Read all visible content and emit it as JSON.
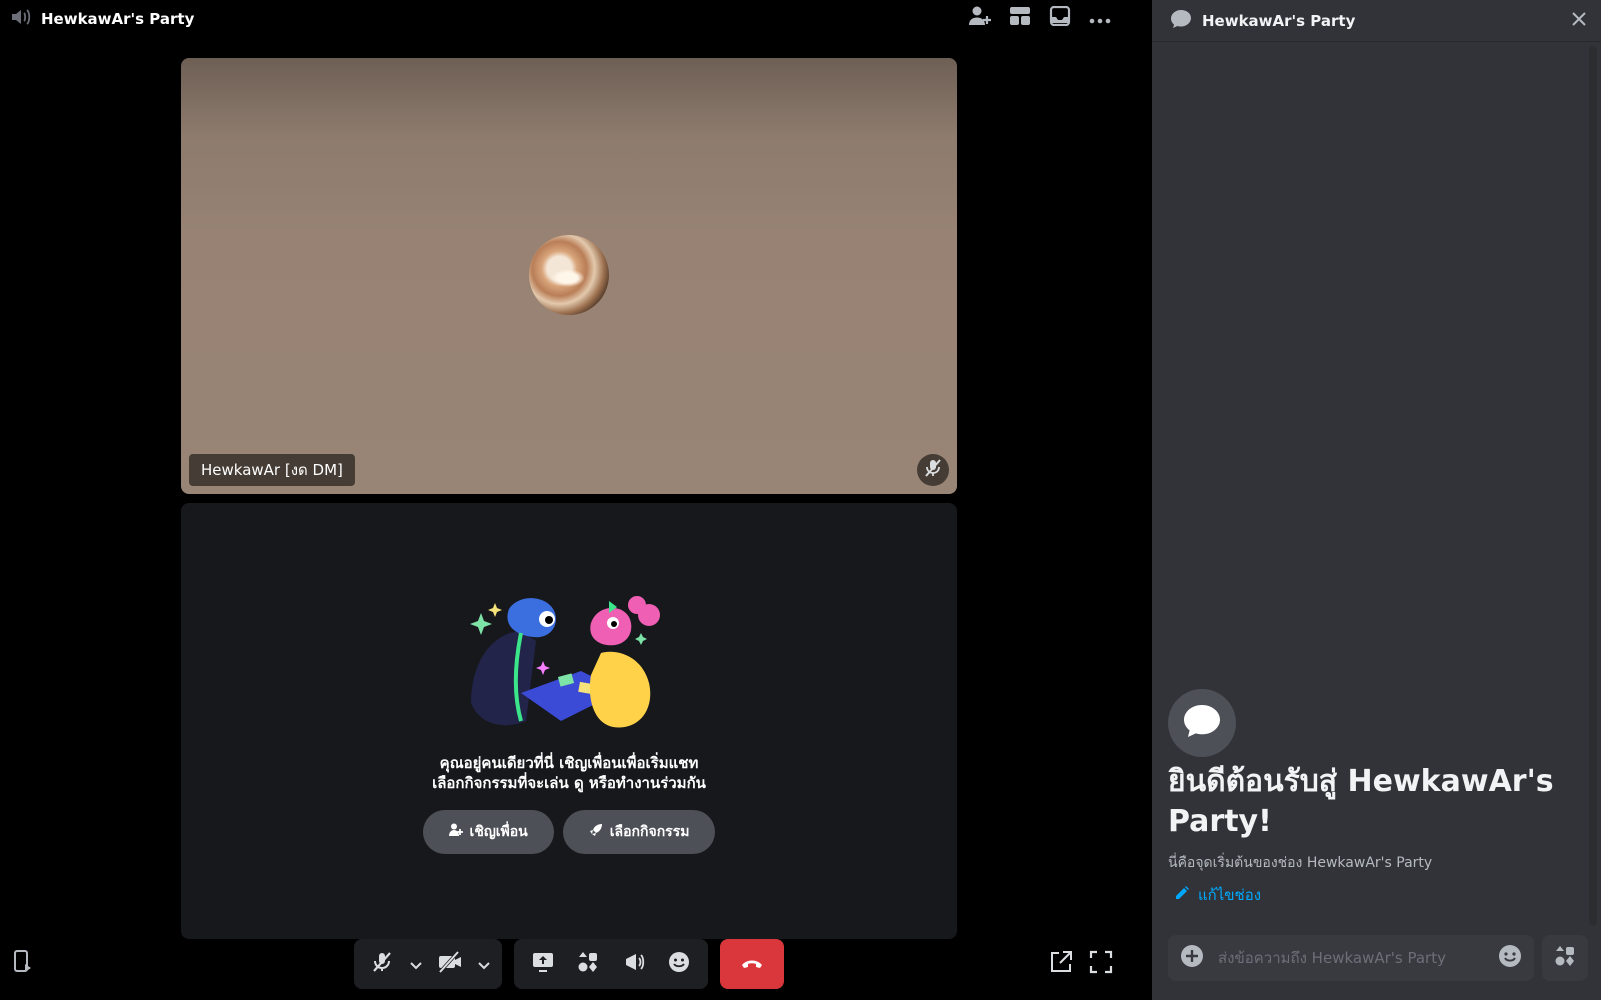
{
  "voice": {
    "header": {
      "title": "HewkawAr's Party"
    },
    "participant": {
      "name": "HewkawAr [งด DM]"
    },
    "empty_state": {
      "line1": "คุณอยู่คนเดียวที่นี่ เชิญเพื่อนเพื่อเริ่มแชท",
      "line2": "เลือกกิจกรรมที่จะเล่น ดู หรือทำงานร่วมกัน",
      "invite_label": "เชิญเพื่อน",
      "activity_label": "เลือกกิจกรรม"
    },
    "icons": [
      "speaker-icon",
      "add-friend-icon",
      "grid-layout-icon",
      "inbox-icon",
      "more-icon",
      "mic-muted-icon",
      "camera-off-icon",
      "screen-share-icon",
      "activity-icon",
      "soundboard-icon",
      "emoji-icon",
      "hangup-icon",
      "popout-icon",
      "fullscreen-icon",
      "device-icon"
    ]
  },
  "chat": {
    "header": {
      "title": "HewkawAr's Party"
    },
    "welcome": {
      "title": "ยินดีต้อนรับสู่ HewkawAr's Party!",
      "subtitle": "นี่คือจุดเริ่มต้นของช่อง HewkawAr's Party",
      "edit_label": "แก้ไขช่อง"
    },
    "composer": {
      "placeholder": "ส่งข้อความถึง HewkawAr's Party"
    }
  },
  "colors": {
    "background": "#000000",
    "panel": "#313338",
    "control_bar": "#1e1f22",
    "hangup": "#da373c",
    "button_gray": "#4e5058",
    "link": "#00a8fc"
  }
}
